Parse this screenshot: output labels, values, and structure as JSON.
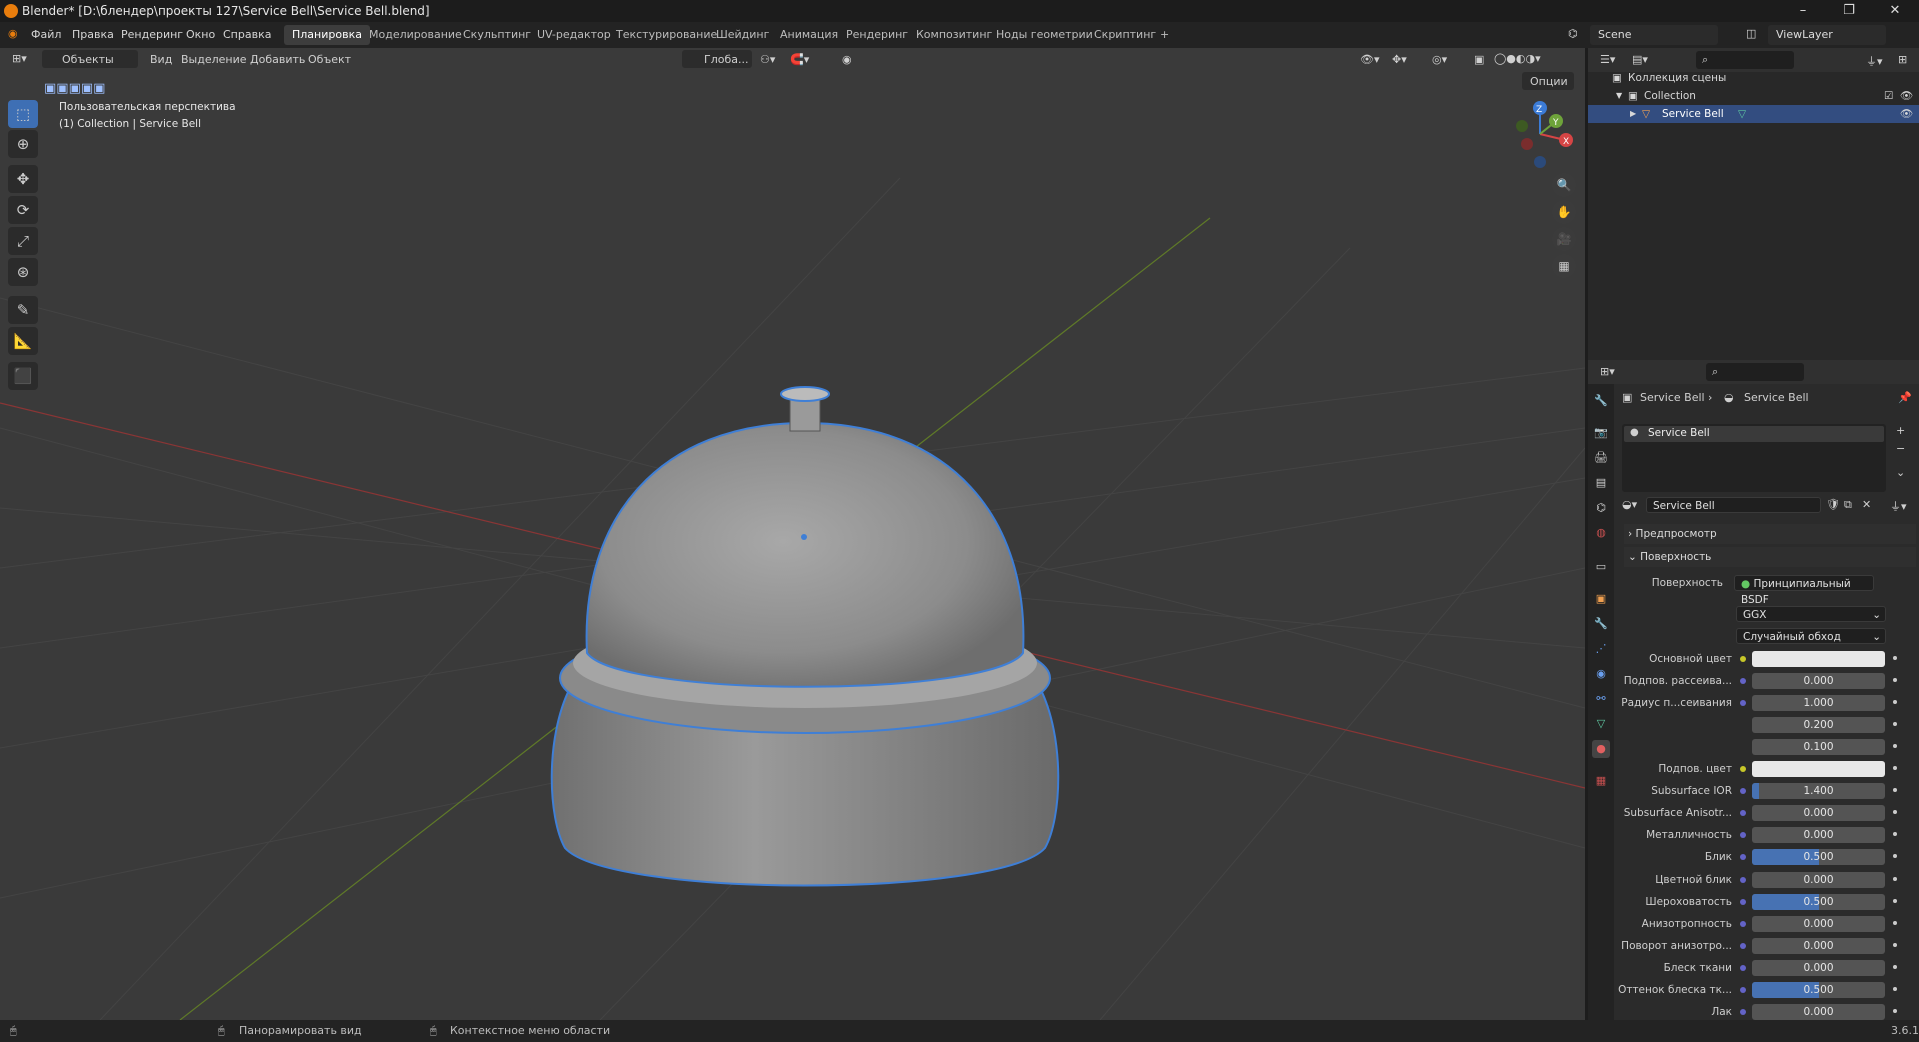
{
  "title": "Blender* [D:\\блендер\\проекты 127\\Service Bell\\Service Bell.blend]",
  "menu": [
    "Файл",
    "Правка",
    "Рендеринг",
    "Окно",
    "Справка"
  ],
  "workspaces": [
    {
      "label": "Планировка",
      "active": true
    },
    {
      "label": "Моделирование"
    },
    {
      "label": "Скульптинг"
    },
    {
      "label": "UV-редактор"
    },
    {
      "label": "Текстурирование"
    },
    {
      "label": "Шейдинг"
    },
    {
      "label": "Анимация"
    },
    {
      "label": "Рендеринг"
    },
    {
      "label": "Композитинг"
    },
    {
      "label": "Ноды геометрии"
    },
    {
      "label": "Скриптинг"
    },
    {
      "label": "+"
    }
  ],
  "scene": "Scene",
  "view_layer": "ViewLayer",
  "viewport": {
    "mode": "Объекты",
    "menu": [
      "Вид",
      "Выделение",
      "Добавить",
      "Объект"
    ],
    "transform": "Глоба...",
    "options": "Опции",
    "overlay_line1": "Пользовательская перспектива",
    "overlay_line2": "(1) Collection | Service Bell",
    "gizmo": {
      "x": "X",
      "y": "Y",
      "z": "Z"
    }
  },
  "outliner": {
    "rows": [
      {
        "label": "Коллекция сцены"
      },
      {
        "label": "Collection"
      },
      {
        "label": "Service Bell"
      }
    ]
  },
  "properties": {
    "breadcrumb": [
      "Service Bell",
      "Service Bell"
    ],
    "material_slot": "Service Bell",
    "material_name": "Service Bell",
    "panels": {
      "preview": "Предпросмотр",
      "surface": "Поверхность"
    },
    "surface_label": "Поверхность",
    "surface_value": "Принципиальный BSDF",
    "distribution": "GGX",
    "subsurface_method": "Случайный обход",
    "rows": [
      {
        "label": "Основной цвет",
        "type": "color",
        "dot": "yel"
      },
      {
        "label": "Подпов. рассеива...",
        "value": "0.000",
        "dot": "blue"
      },
      {
        "label": "Радиус п...сеивания",
        "value": "1.000",
        "dot": "blue"
      },
      {
        "label": "",
        "value": "0.200"
      },
      {
        "label": "",
        "value": "0.100"
      },
      {
        "label": "Подпов. цвет",
        "type": "color",
        "dot": "yel"
      },
      {
        "label": "Subsurface IOR",
        "value": "1.400",
        "fill": 0.1,
        "dot": "blue"
      },
      {
        "label": "Subsurface Anisotr...",
        "value": "0.000",
        "dot": "blue"
      },
      {
        "label": "Металличность",
        "value": "0.000",
        "dot": "blue"
      },
      {
        "label": "Блик",
        "value": "0.500",
        "fill": 1,
        "dot": "blue"
      },
      {
        "label": "Цветной блик",
        "value": "0.000",
        "dot": "blue"
      },
      {
        "label": "Шероховатость",
        "value": "0.500",
        "fill": 1,
        "dot": "blue"
      },
      {
        "label": "Анизотропность",
        "value": "0.000",
        "dot": "blue"
      },
      {
        "label": "Поворот анизотро...",
        "value": "0.000",
        "dot": "blue"
      },
      {
        "label": "Блеск ткани",
        "value": "0.000",
        "dot": "blue"
      },
      {
        "label": "Оттенок блеска тк...",
        "value": "0.500",
        "fill": 1,
        "dot": "blue"
      },
      {
        "label": "Лак",
        "value": "0.000",
        "dot": "blue"
      }
    ]
  },
  "status": {
    "pan": "Панорамировать вид",
    "context": "Контекстное меню области",
    "version": "3.6.1"
  }
}
